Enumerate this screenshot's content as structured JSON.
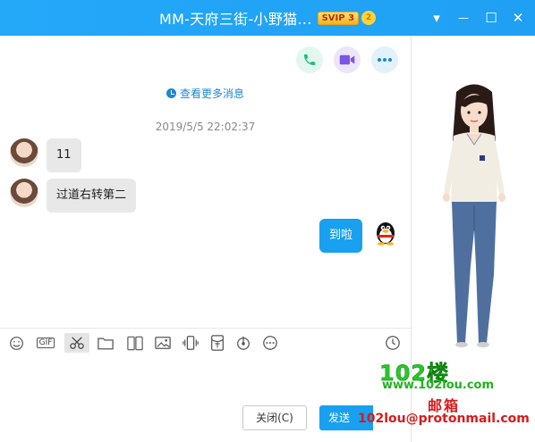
{
  "window": {
    "title": "MM-天府三街-小野猫...",
    "vip_badge": "SVIP 3",
    "crown_badge": "2",
    "controls": {
      "dropdown": "▾",
      "minimize": "—",
      "maximize": "☐",
      "close": "✕"
    }
  },
  "header_actions": {
    "voice_call_icon": "phone-icon",
    "video_call_icon": "video-camera-icon",
    "more_icon": "more-dots-icon",
    "colors": {
      "voice": "#21b97a",
      "video": "#7b55e6",
      "more": "#1b87d6"
    }
  },
  "chat": {
    "more_messages": "查看更多消息",
    "timestamp": "2019/5/5 22:02:37",
    "messages": [
      {
        "from": "other",
        "text": "11"
      },
      {
        "from": "other",
        "text": "过道右转第二"
      },
      {
        "from": "me",
        "text": "到啦"
      }
    ]
  },
  "toolbar": {
    "icons": [
      "emoji-icon",
      "gif-icon",
      "scissors-icon",
      "folder-icon",
      "image-edit-icon",
      "image-icon",
      "shake-icon",
      "red-packet-icon",
      "music-icon",
      "more-icon"
    ],
    "gif_label": "GIF",
    "history_icon": "history-clock-icon"
  },
  "actions": {
    "close_label": "关闭(C)",
    "send_label": "发送"
  },
  "watermark": {
    "line1": "102楼",
    "line2": "www.102lou.com",
    "line3": "邮箱",
    "line4": "102lou@protonmail.com"
  },
  "colors": {
    "accent": "#19a0f0",
    "titlebar": "#24a8f8"
  }
}
